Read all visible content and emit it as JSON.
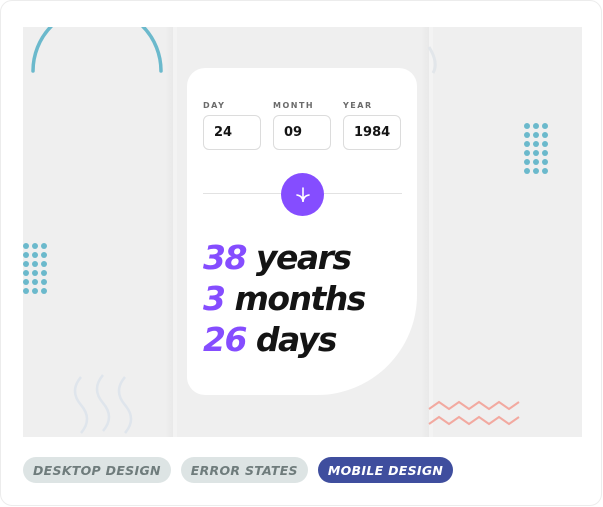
{
  "fields": [
    {
      "label": "DAY",
      "value": "24"
    },
    {
      "label": "MONTH",
      "value": "09"
    },
    {
      "label": "YEAR",
      "value": "1984"
    }
  ],
  "submit": {
    "icon": "arrow-down-icon"
  },
  "result": {
    "years": {
      "num": "38",
      "unit": " years"
    },
    "months": {
      "num": "3",
      "unit": " months"
    },
    "days": {
      "num": "26",
      "unit": " days"
    }
  },
  "tags": [
    {
      "label": "DESKTOP DESIGN",
      "active": false
    },
    {
      "label": "ERROR STATES",
      "active": false
    },
    {
      "label": "MOBILE DESIGN",
      "active": true
    }
  ],
  "colors": {
    "accent": "#854dff",
    "tag_active": "#3f4e9e",
    "tag_inactive": "#dde4e4",
    "deco_teal": "#6bb9cc",
    "deco_coral": "#f2a9a0"
  }
}
